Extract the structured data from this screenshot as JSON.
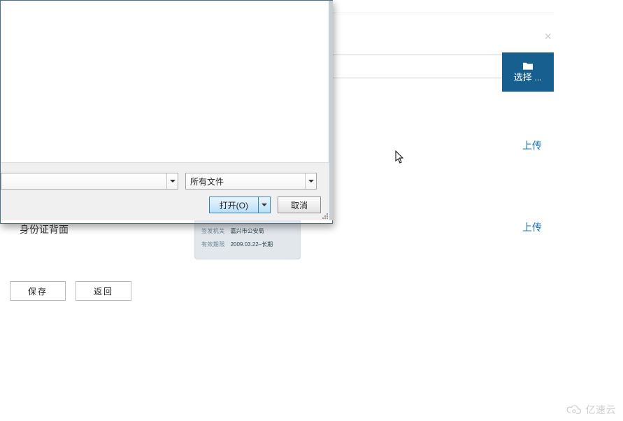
{
  "page": {
    "close_icon": "×",
    "select_button_label": "选择 ...",
    "upload_links": [
      "上传",
      "上传"
    ],
    "id_back_label": "身份证背面",
    "id_card": {
      "row1_label": "签发机关",
      "row1_value": "嘉兴市公安局",
      "row2_label": "有效期限",
      "row2_value": "2009.03.22–长期"
    },
    "save_button": "保存",
    "back_button": "返回"
  },
  "dialog": {
    "filename_value": "",
    "filter_value": "所有文件",
    "open_button": "打开(O)",
    "cancel_button": "取消"
  },
  "watermark": {
    "text": "亿速云"
  }
}
